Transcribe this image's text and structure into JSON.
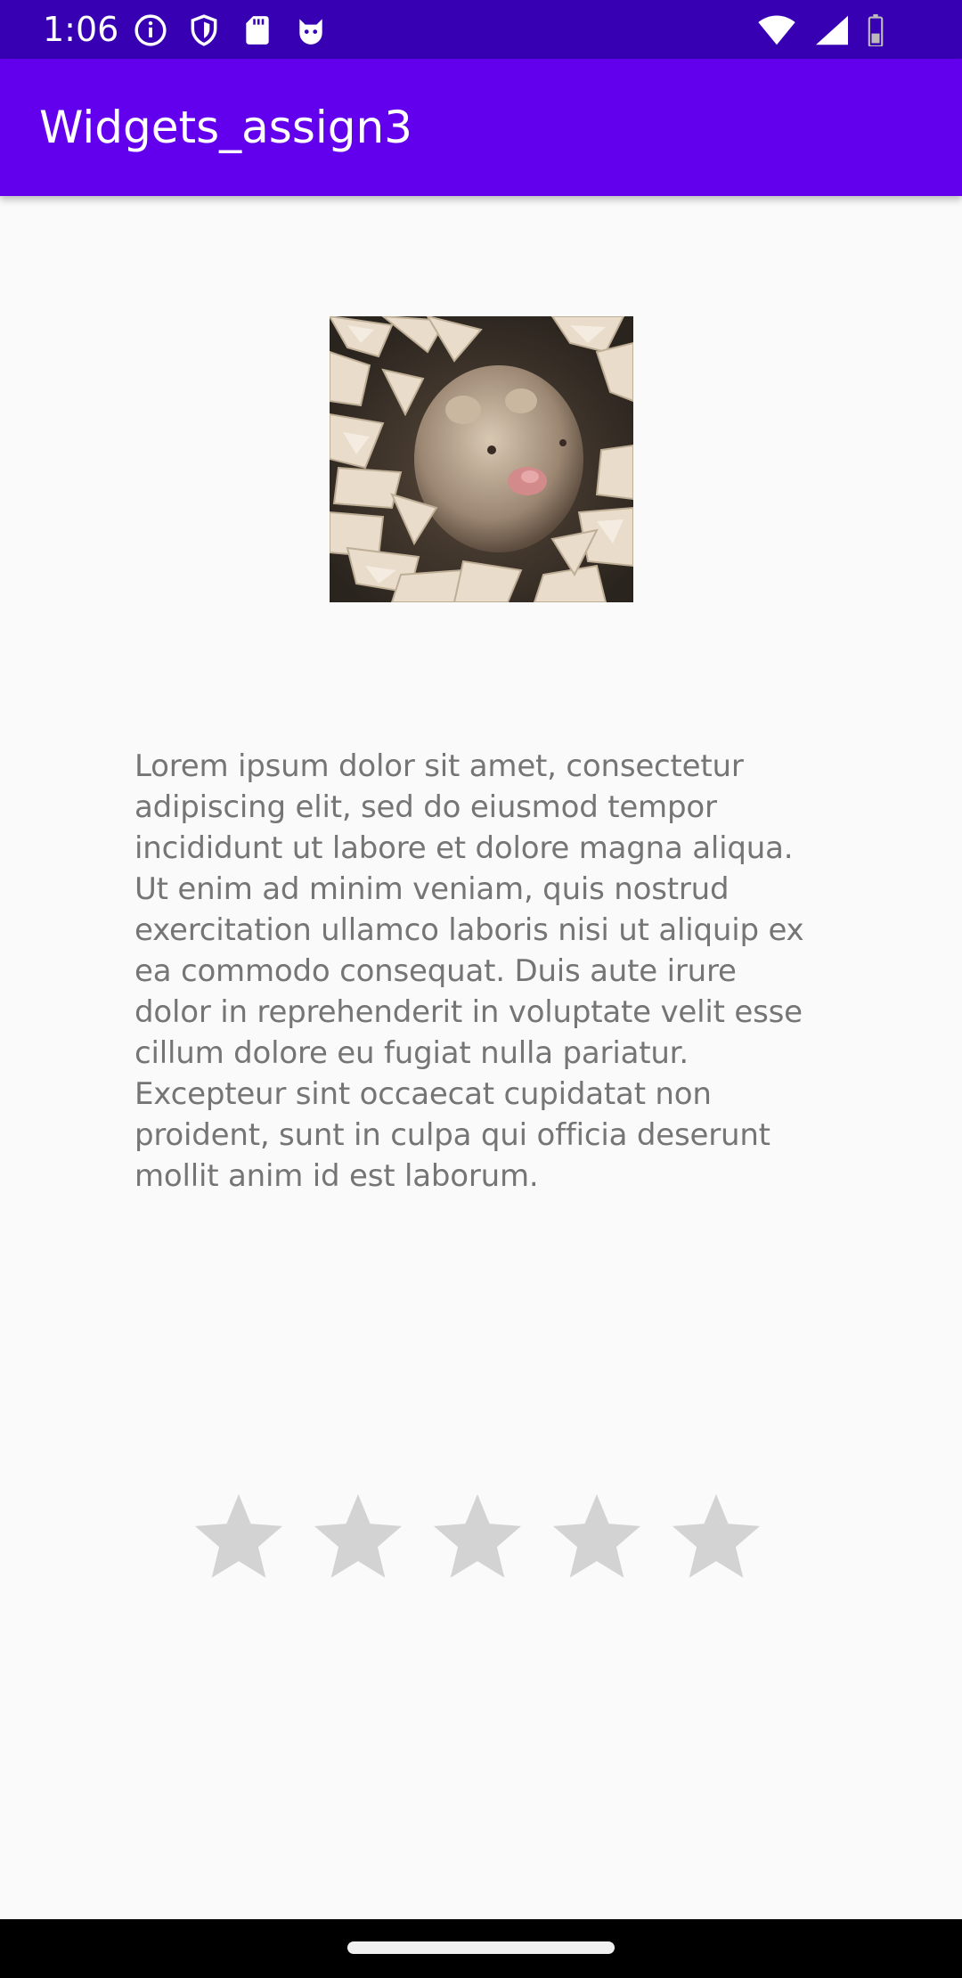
{
  "status_bar": {
    "time": "1:06",
    "left_icons": [
      "info-icon",
      "shield-icon",
      "sd-card-icon",
      "cat-face-icon"
    ],
    "right_icons": [
      "wifi-icon",
      "signal-icon",
      "battery-icon"
    ],
    "background": "#3700b3"
  },
  "app_bar": {
    "title": "Widgets_assign3",
    "background": "#6200ee"
  },
  "image": {
    "subject": "hamster in wood shavings"
  },
  "body": {
    "text": "Lorem ipsum dolor sit amet, consectetur adipiscing elit, sed do eiusmod tempor incididunt ut labore et dolore magna aliqua. Ut enim ad minim veniam, quis nostrud exercitation ullamco laboris nisi ut aliquip ex ea commodo consequat. Duis aute irure dolor in reprehenderit in voluptate velit esse cillum dolore eu fugiat nulla pariatur. Excepteur sint occaecat cupidatat non proident, sunt in culpa qui officia deserunt mollit anim id est laborum."
  },
  "rating": {
    "max": 5,
    "value": 0,
    "empty_color": "#d3d3d3"
  },
  "nav_bar": {
    "background": "#000000"
  }
}
